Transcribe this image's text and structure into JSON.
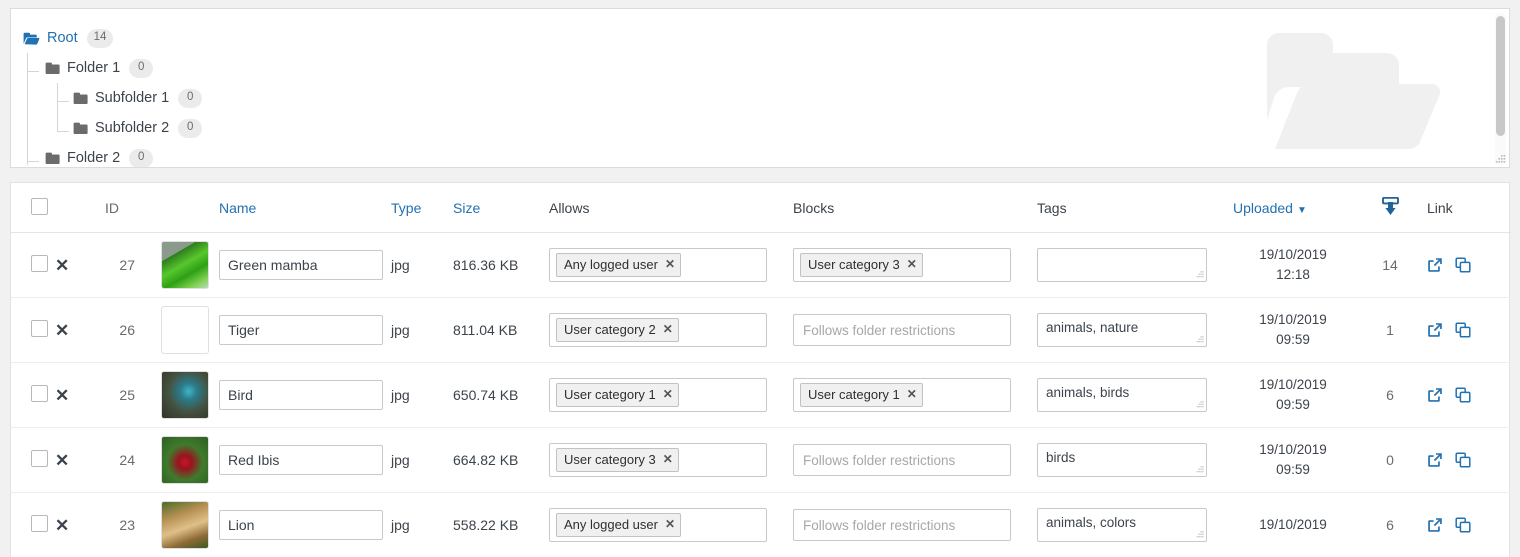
{
  "tree": {
    "nodes": [
      {
        "label": "Root",
        "count": "14",
        "depth": 0,
        "icon": "folder-open-icon",
        "is_root": true
      },
      {
        "label": "Folder 1",
        "count": "0",
        "depth": 1,
        "icon": "folder-icon",
        "is_root": false
      },
      {
        "label": "Subfolder 1",
        "count": "0",
        "depth": 2,
        "icon": "folder-icon",
        "is_root": false
      },
      {
        "label": "Subfolder 2",
        "count": "0",
        "depth": 2,
        "icon": "folder-icon",
        "is_root": false
      },
      {
        "label": "Folder 2",
        "count": "0",
        "depth": 1,
        "icon": "folder-icon",
        "is_root": false
      }
    ],
    "watermark_icon": "folder-open-watermark-icon",
    "scrollbar": "vertical-scrollbar",
    "resize_grip": "panel-resize-grip"
  },
  "table": {
    "headers": {
      "select_all": "",
      "delete": "",
      "id": "ID",
      "thumbnail": "",
      "name": "Name",
      "type": "Type",
      "size": "Size",
      "allows": "Allows",
      "blocks": "Blocks",
      "tags": "Tags",
      "uploaded": "Uploaded",
      "uploaded_sort_caret": "▼",
      "downloads_icon": "download-icon",
      "link": "Link"
    },
    "placeholders": {
      "blocks_empty": "Follows folder restrictions",
      "allows_empty": "",
      "tags_empty": ""
    },
    "rows": [
      {
        "id": "27",
        "name": "Green mamba",
        "type": "jpg",
        "size": "816.36 KB",
        "allows": "Any logged user",
        "blocks": "User category 3",
        "tags": "",
        "uploaded_date": "19/10/2019",
        "uploaded_time": "12:18",
        "downloads": "14",
        "thumb": "green-snake"
      },
      {
        "id": "26",
        "name": "Tiger",
        "type": "jpg",
        "size": "811.04 KB",
        "allows": "User category 2",
        "blocks": "",
        "tags": "animals, nature",
        "uploaded_date": "19/10/2019",
        "uploaded_time": "09:59",
        "downloads": "1",
        "thumb": "tiger"
      },
      {
        "id": "25",
        "name": "Bird",
        "type": "jpg",
        "size": "650.74 KB",
        "allows": "User category 1",
        "blocks": "User category 1",
        "tags": "animals, birds",
        "uploaded_date": "19/10/2019",
        "uploaded_time": "09:59",
        "downloads": "6",
        "thumb": "kingfisher"
      },
      {
        "id": "24",
        "name": "Red Ibis",
        "type": "jpg",
        "size": "664.82 KB",
        "allows": "User category 3",
        "blocks": "",
        "tags": "birds",
        "uploaded_date": "19/10/2019",
        "uploaded_time": "09:59",
        "downloads": "0",
        "thumb": "red-flower"
      },
      {
        "id": "23",
        "name": "Lion",
        "type": "jpg",
        "size": "558.22 KB",
        "allows": "Any logged user",
        "blocks": "",
        "tags": "animals, colors",
        "uploaded_date": "19/10/2019",
        "uploaded_time": "",
        "downloads": "6",
        "thumb": "lion"
      }
    ],
    "row_icons": {
      "delete": "✕",
      "open_link_icon": "external-link-icon",
      "copy_link_icon": "copy-icon"
    }
  },
  "colors": {
    "link_blue": "#2271b1",
    "icon_blue": "#1f6398",
    "text": "#3c434a",
    "muted": "#a7a7a7",
    "page_bg": "#f1f1f1",
    "panel_bg": "#ffffff",
    "border": "#e2e2e2"
  }
}
